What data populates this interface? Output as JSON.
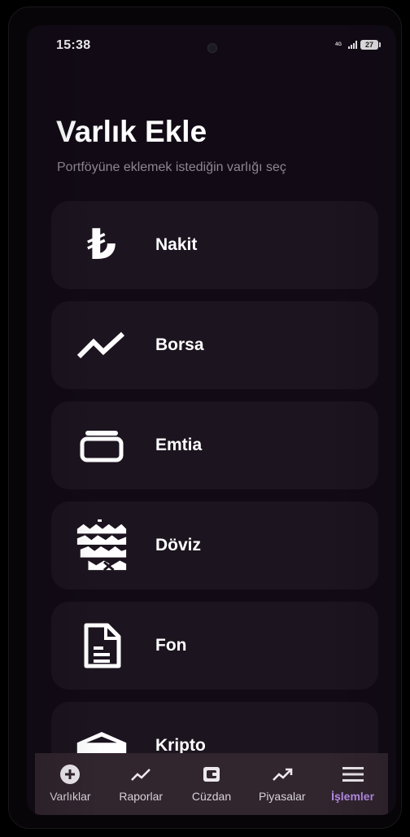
{
  "status_bar": {
    "time": "15:38",
    "network_label": "4G",
    "battery": "27"
  },
  "page": {
    "title": "Varlık Ekle",
    "subtitle": "Portföyüne eklemek istediğin varlığı seç"
  },
  "assets": [
    {
      "label": "Nakit",
      "icon": "lira-icon"
    },
    {
      "label": "Borsa",
      "icon": "trend-icon"
    },
    {
      "label": "Emtia",
      "icon": "wallet-icon"
    },
    {
      "label": "Döviz",
      "icon": "pattern-icon"
    },
    {
      "label": "Fon",
      "icon": "document-icon"
    },
    {
      "label": "Kripto",
      "icon": "box-icon"
    }
  ],
  "nav": [
    {
      "label": "Varlıklar",
      "icon": "add-circle-icon",
      "active": false
    },
    {
      "label": "Raporlar",
      "icon": "chart-line-icon",
      "active": false
    },
    {
      "label": "Cüzdan",
      "icon": "wallet-icon",
      "active": false
    },
    {
      "label": "Piyasalar",
      "icon": "trending-up-icon",
      "active": false
    },
    {
      "label": "İşlemler",
      "icon": "menu-icon",
      "active": true
    }
  ],
  "colors": {
    "background": "#120b16",
    "card": "#1c141f",
    "nav_background": "#31252e",
    "accent": "#b48ce6"
  },
  "lira_symbol": "₺"
}
